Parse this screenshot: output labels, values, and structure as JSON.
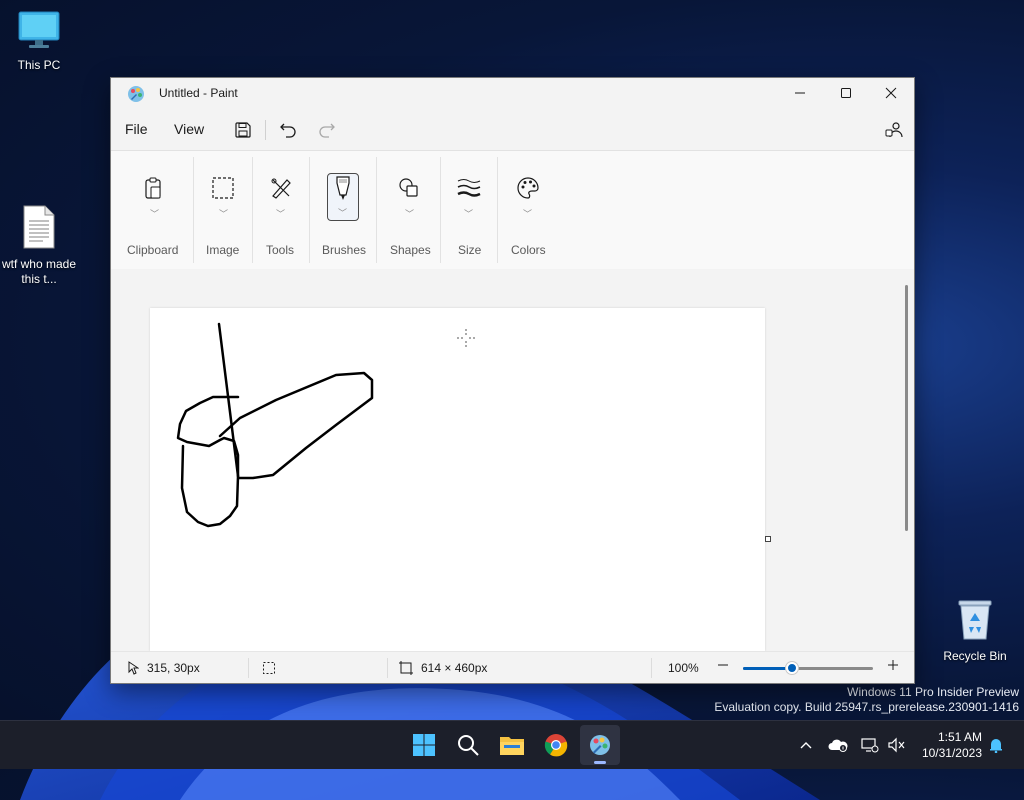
{
  "desktop": {
    "icons": [
      {
        "label": "This PC",
        "icon": "monitor-icon"
      },
      {
        "label": "wtf who made this t...",
        "icon": "text-document-icon"
      },
      {
        "label": "Recycle Bin",
        "icon": "recycle-bin-icon"
      }
    ],
    "watermark": {
      "line1": "Windows 11 Pro Insider Preview",
      "line2": "Evaluation copy. Build 25947.rs_prerelease.230901-1416"
    }
  },
  "window": {
    "title": "Untitled - Paint",
    "controls": [
      "minimize-icon",
      "maximize-icon",
      "close-icon"
    ],
    "menu": {
      "file": "File",
      "view": "View",
      "icons": [
        "save-icon",
        "undo-icon",
        "redo-icon",
        "account-settings-icon"
      ]
    },
    "ribbon": {
      "groups": [
        {
          "label": "Clipboard",
          "icon": "clipboard-icon"
        },
        {
          "label": "Image",
          "icon": "selection-icon"
        },
        {
          "label": "Tools",
          "icon": "tools-icon"
        },
        {
          "label": "Brushes",
          "icon": "brush-icon",
          "selected": true
        },
        {
          "label": "Shapes",
          "icon": "shapes-icon"
        },
        {
          "label": "Size",
          "icon": "stroke-size-icon"
        },
        {
          "label": "Colors",
          "icon": "palette-icon"
        }
      ]
    },
    "status": {
      "cursor_position": "315, 30px",
      "canvas_size": "614 × 460px",
      "zoom": "100%",
      "zoom_level": 0.38
    }
  },
  "taskbar": {
    "apps": [
      "start-icon",
      "search-icon",
      "file-explorer-icon",
      "chrome-icon",
      "paint-icon"
    ],
    "active_app": "paint-icon",
    "tray": [
      "chevron-up-icon",
      "onedrive-icon",
      "network-icon",
      "volume-muted-icon",
      "notification-bell-icon"
    ],
    "time": "1:51 AM",
    "date": "10/31/2023"
  },
  "colors": {
    "accent": "#005fb8",
    "window_bg": "#f3f3f3",
    "taskbar_bg": "#1c1f2a"
  }
}
